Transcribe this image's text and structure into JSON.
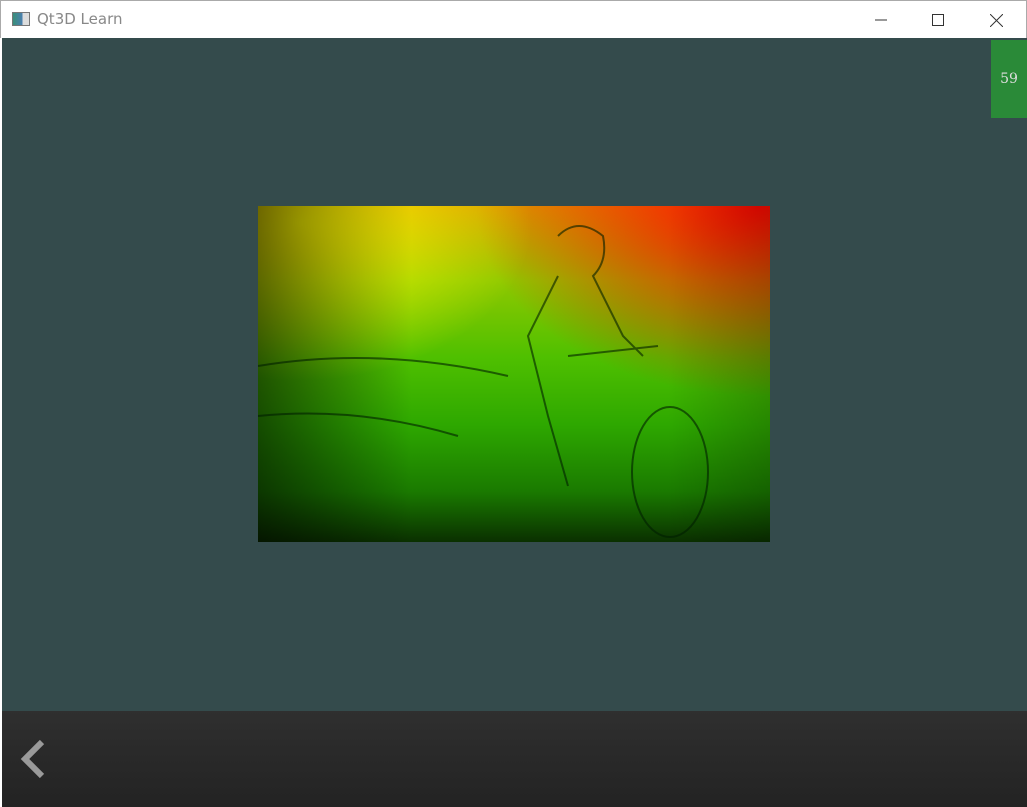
{
  "window": {
    "title": "Qt3D Learn",
    "app_icon": "qt-window-icon"
  },
  "controls": {
    "minimize": "minimize-icon",
    "maximize": "maximize-icon",
    "close": "close-icon"
  },
  "fps_counter": {
    "value": "59",
    "color": "#2a8a38"
  },
  "scene": {
    "background_color": "#344b4c",
    "image": "textured-quad-cyclist-sketch"
  },
  "bottom_bar": {
    "back_icon": "chevron-left-icon"
  }
}
